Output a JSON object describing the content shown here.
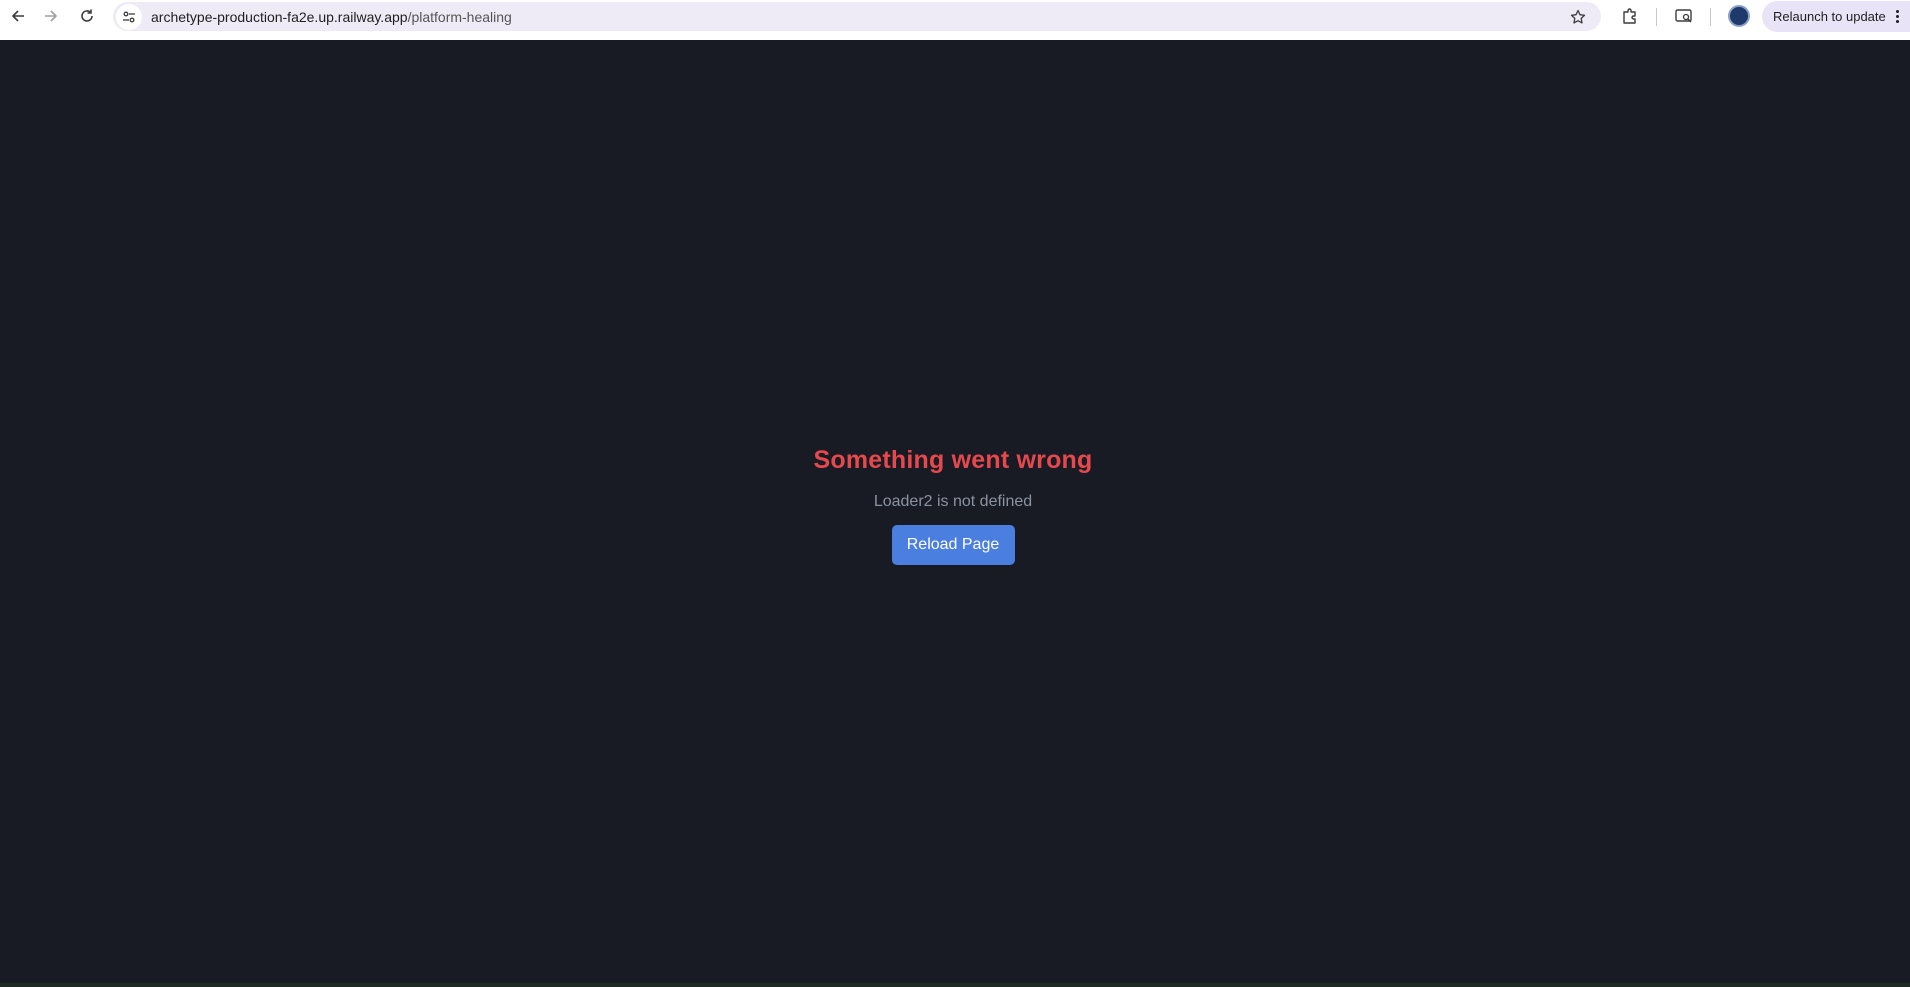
{
  "browser": {
    "url_host": "archetype-production-fa2e.up.railway.app",
    "url_path": "/platform-healing",
    "relaunch_label": "Relaunch to update",
    "icons": [
      "back-arrow-icon",
      "forward-arrow-icon",
      "reload-icon",
      "site-info-icon",
      "bookmark-star-icon",
      "extensions-icon",
      "search-tab-icon",
      "profile-avatar-icon",
      "more-menu-icon"
    ]
  },
  "error": {
    "title": "Something went wrong",
    "message": "Loader2 is not defined",
    "reload_label": "Reload Page"
  },
  "colors": {
    "page_background": "#181b23",
    "error_title": "#e5484d",
    "button": "#4a7fe0"
  }
}
